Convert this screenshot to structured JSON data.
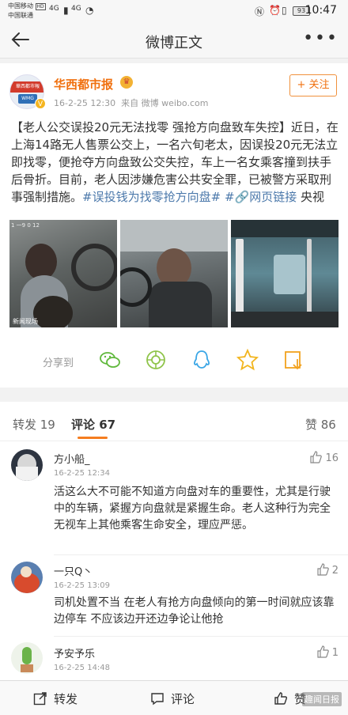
{
  "status_bar": {
    "carrier_1": "中国移动",
    "carrier_1_badge": "HD",
    "carrier_2": "中国联通",
    "signal_1": "4G",
    "signal_2": "4G",
    "battery": "93",
    "time": "10:47"
  },
  "nav": {
    "title": "微博正文"
  },
  "post": {
    "author": "华西都市报",
    "avatar_text": "華西都市報",
    "avatar_sub": "WMG",
    "time": "16-2-25 12:30",
    "source": "来自 微博 weibo.com",
    "follow_label": "+ 关注",
    "text_main": "【老人公交误投20元无法找零 强抢方向盘致车失控】近日，在上海14路无人售票公交上，一名六旬老太，因误投20元无法立即找零，便抢夺方向盘致公交失控，车上一名女乘客撞到扶手后骨折。目前，老人因涉嫌危害公共安全罪，已被警方采取刑事强制措施。",
    "topic": "#误投钱为找零抢方向盘#",
    "link": "网页链接",
    "link_suffix": " 央视",
    "photo_1_tag": "1 一9 0 12",
    "photo_1_caption": "新闻现场"
  },
  "share": {
    "label": "分享到"
  },
  "tabs": [
    {
      "label": "转发 19"
    },
    {
      "label": "评论 67"
    },
    {
      "label": "赞 86"
    }
  ],
  "comments": [
    {
      "name": "方小船_",
      "time": "16-2-25 12:34",
      "likes": "16",
      "text": "活这么大不可能不知道方向盘对车的重要性，尤其是行驶中的车辆，紧握方向盘就是紧握生命。老人这种行为完全无视车上其他乘客生命安全，理应严惩。"
    },
    {
      "name": "一只Q丶",
      "time": "16-2-25 13:09",
      "likes": "2",
      "text": "司机处置不当 在老人有抢方向盘倾向的第一时间就应该靠边停车 不应该边开还边争论让他抢"
    },
    {
      "name": "予安予乐",
      "time": "16-2-25 14:48",
      "likes": "1",
      "text": ""
    }
  ],
  "bottom_bar": {
    "repost": "转发",
    "comment": "评论",
    "like": "赞",
    "watermark": "趣闻日报"
  },
  "colors": {
    "accent": "#f57d1f",
    "author": "#f0700f",
    "link": "#4c79ab"
  }
}
